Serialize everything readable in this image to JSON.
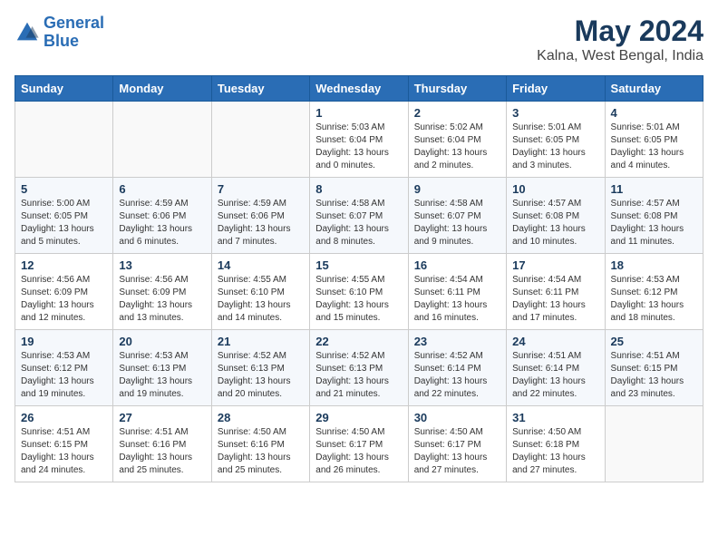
{
  "logo": {
    "line1": "General",
    "line2": "Blue"
  },
  "title": "May 2024",
  "subtitle": "Kalna, West Bengal, India",
  "days_of_week": [
    "Sunday",
    "Monday",
    "Tuesday",
    "Wednesday",
    "Thursday",
    "Friday",
    "Saturday"
  ],
  "weeks": [
    [
      {
        "day": "",
        "info": ""
      },
      {
        "day": "",
        "info": ""
      },
      {
        "day": "",
        "info": ""
      },
      {
        "day": "1",
        "info": "Sunrise: 5:03 AM\nSunset: 6:04 PM\nDaylight: 13 hours\nand 0 minutes."
      },
      {
        "day": "2",
        "info": "Sunrise: 5:02 AM\nSunset: 6:04 PM\nDaylight: 13 hours\nand 2 minutes."
      },
      {
        "day": "3",
        "info": "Sunrise: 5:01 AM\nSunset: 6:05 PM\nDaylight: 13 hours\nand 3 minutes."
      },
      {
        "day": "4",
        "info": "Sunrise: 5:01 AM\nSunset: 6:05 PM\nDaylight: 13 hours\nand 4 minutes."
      }
    ],
    [
      {
        "day": "5",
        "info": "Sunrise: 5:00 AM\nSunset: 6:05 PM\nDaylight: 13 hours\nand 5 minutes."
      },
      {
        "day": "6",
        "info": "Sunrise: 4:59 AM\nSunset: 6:06 PM\nDaylight: 13 hours\nand 6 minutes."
      },
      {
        "day": "7",
        "info": "Sunrise: 4:59 AM\nSunset: 6:06 PM\nDaylight: 13 hours\nand 7 minutes."
      },
      {
        "day": "8",
        "info": "Sunrise: 4:58 AM\nSunset: 6:07 PM\nDaylight: 13 hours\nand 8 minutes."
      },
      {
        "day": "9",
        "info": "Sunrise: 4:58 AM\nSunset: 6:07 PM\nDaylight: 13 hours\nand 9 minutes."
      },
      {
        "day": "10",
        "info": "Sunrise: 4:57 AM\nSunset: 6:08 PM\nDaylight: 13 hours\nand 10 minutes."
      },
      {
        "day": "11",
        "info": "Sunrise: 4:57 AM\nSunset: 6:08 PM\nDaylight: 13 hours\nand 11 minutes."
      }
    ],
    [
      {
        "day": "12",
        "info": "Sunrise: 4:56 AM\nSunset: 6:09 PM\nDaylight: 13 hours\nand 12 minutes."
      },
      {
        "day": "13",
        "info": "Sunrise: 4:56 AM\nSunset: 6:09 PM\nDaylight: 13 hours\nand 13 minutes."
      },
      {
        "day": "14",
        "info": "Sunrise: 4:55 AM\nSunset: 6:10 PM\nDaylight: 13 hours\nand 14 minutes."
      },
      {
        "day": "15",
        "info": "Sunrise: 4:55 AM\nSunset: 6:10 PM\nDaylight: 13 hours\nand 15 minutes."
      },
      {
        "day": "16",
        "info": "Sunrise: 4:54 AM\nSunset: 6:11 PM\nDaylight: 13 hours\nand 16 minutes."
      },
      {
        "day": "17",
        "info": "Sunrise: 4:54 AM\nSunset: 6:11 PM\nDaylight: 13 hours\nand 17 minutes."
      },
      {
        "day": "18",
        "info": "Sunrise: 4:53 AM\nSunset: 6:12 PM\nDaylight: 13 hours\nand 18 minutes."
      }
    ],
    [
      {
        "day": "19",
        "info": "Sunrise: 4:53 AM\nSunset: 6:12 PM\nDaylight: 13 hours\nand 19 minutes."
      },
      {
        "day": "20",
        "info": "Sunrise: 4:53 AM\nSunset: 6:13 PM\nDaylight: 13 hours\nand 19 minutes."
      },
      {
        "day": "21",
        "info": "Sunrise: 4:52 AM\nSunset: 6:13 PM\nDaylight: 13 hours\nand 20 minutes."
      },
      {
        "day": "22",
        "info": "Sunrise: 4:52 AM\nSunset: 6:13 PM\nDaylight: 13 hours\nand 21 minutes."
      },
      {
        "day": "23",
        "info": "Sunrise: 4:52 AM\nSunset: 6:14 PM\nDaylight: 13 hours\nand 22 minutes."
      },
      {
        "day": "24",
        "info": "Sunrise: 4:51 AM\nSunset: 6:14 PM\nDaylight: 13 hours\nand 22 minutes."
      },
      {
        "day": "25",
        "info": "Sunrise: 4:51 AM\nSunset: 6:15 PM\nDaylight: 13 hours\nand 23 minutes."
      }
    ],
    [
      {
        "day": "26",
        "info": "Sunrise: 4:51 AM\nSunset: 6:15 PM\nDaylight: 13 hours\nand 24 minutes."
      },
      {
        "day": "27",
        "info": "Sunrise: 4:51 AM\nSunset: 6:16 PM\nDaylight: 13 hours\nand 25 minutes."
      },
      {
        "day": "28",
        "info": "Sunrise: 4:50 AM\nSunset: 6:16 PM\nDaylight: 13 hours\nand 25 minutes."
      },
      {
        "day": "29",
        "info": "Sunrise: 4:50 AM\nSunset: 6:17 PM\nDaylight: 13 hours\nand 26 minutes."
      },
      {
        "day": "30",
        "info": "Sunrise: 4:50 AM\nSunset: 6:17 PM\nDaylight: 13 hours\nand 27 minutes."
      },
      {
        "day": "31",
        "info": "Sunrise: 4:50 AM\nSunset: 6:18 PM\nDaylight: 13 hours\nand 27 minutes."
      },
      {
        "day": "",
        "info": ""
      }
    ]
  ]
}
